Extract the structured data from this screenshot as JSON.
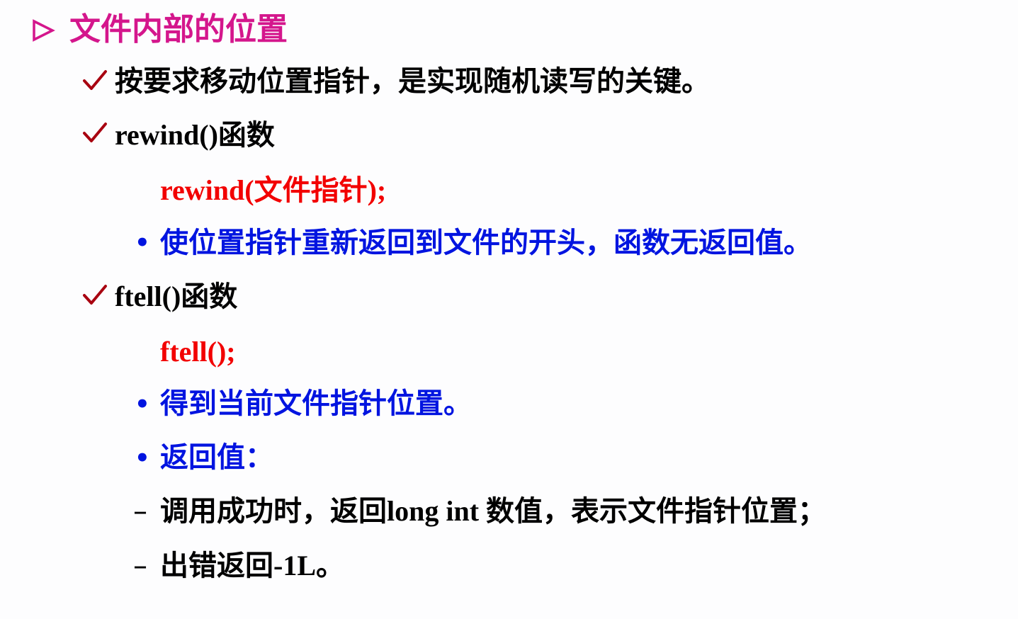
{
  "colors": {
    "heading": "#d4168c",
    "check": "#a80010",
    "black": "#000000",
    "red": "#f20000",
    "blue": "#0014e0"
  },
  "heading": {
    "arrow_icon": "triangle-right-outline",
    "text": "文件内部的位置"
  },
  "items": {
    "item1": {
      "check_icon": "checkmark",
      "text": "按要求移动位置指针，是实现随机读写的关键。"
    },
    "item2": {
      "check_icon": "checkmark",
      "code_part": "rewind()",
      "cjk_part": "函数",
      "usage_code_a": "rewind(",
      "usage_cjk": "文件指针",
      "usage_code_b": ");",
      "desc_bullet": "•",
      "desc": "使位置指针重新返回到文件的开头，函数无返回值。"
    },
    "item3": {
      "check_icon": "checkmark",
      "code_part": "ftell()",
      "cjk_part": "函数",
      "usage_code": "ftell();",
      "desc1_bullet": "•",
      "desc1": "得到当前文件指针位置。",
      "desc2_bullet": "•",
      "desc2": "返回值：",
      "sub1_dash": "–",
      "sub1_a": "调用成功时，返回",
      "sub1_code": "long int ",
      "sub1_b": "数值，表示文件指针位置；",
      "sub2_dash": "–",
      "sub2_a": "出错返回",
      "sub2_code": "-1L",
      "sub2_b": "。"
    }
  }
}
